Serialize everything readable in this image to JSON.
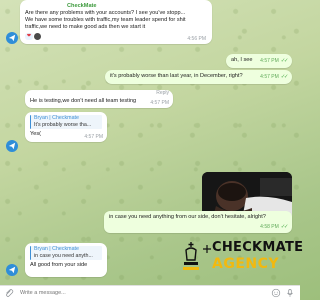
{
  "messages": {
    "m1": {
      "sender": "CheckMate",
      "line1": "Are there any problems with your accounts? I see you've stopp...",
      "line2": "We have some troubles with traffic,my team leader spend for shit",
      "line3": "traffic,we need to make good ads then we start it",
      "time": "4:56 PM"
    },
    "m2": {
      "text": "ah, I see",
      "time": "4:57 PM"
    },
    "m3": {
      "text": "it's probably worse than last year, in December, right?",
      "time": "4:57 PM"
    },
    "m4": {
      "text": "He is testing,we don't need all team testing",
      "time": "4:57 PM",
      "reply_label": "Reply"
    },
    "m5": {
      "quote_name": "Bryan | Checkmate",
      "quote_text": "It's probably worse tha...",
      "text": "Yes(",
      "time": "4:57 PM"
    },
    "m6": {
      "text": "in case you need anything from our side, don't hesitate, alright?",
      "time": "4:58 PM"
    },
    "m7": {
      "quote_name": "Bryan | Checkmate",
      "quote_text": "in case you need anyth...",
      "text": "All good from your side"
    }
  },
  "composer": {
    "placeholder": "Write a message..."
  },
  "brand": {
    "line1": "CHECKMATE",
    "line2": "AGENCY"
  },
  "colors": {
    "accent": "#3d8fd6",
    "sender": "#3d9a3d",
    "brand_yellow": "#f2b90f"
  }
}
